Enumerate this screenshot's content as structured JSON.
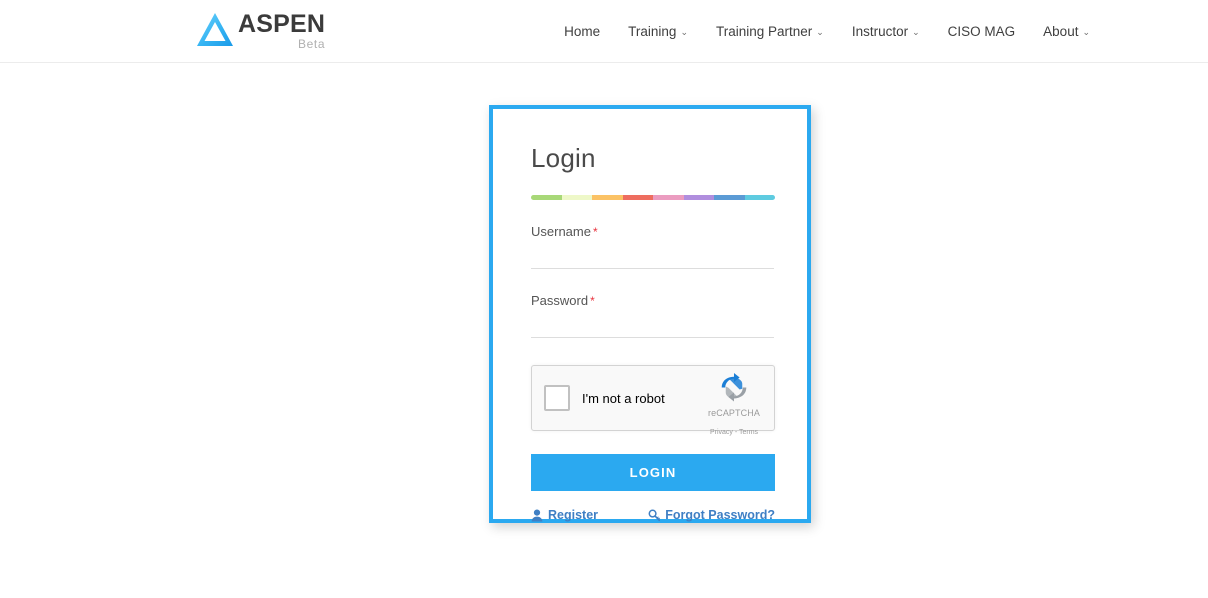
{
  "header": {
    "brand": {
      "name": "ASPEN",
      "sub": "Beta",
      "logo_icon": "triangle-logo-icon",
      "logo_gradient_from": "#5ec8f8",
      "logo_gradient_to": "#1a9ae8"
    },
    "nav": [
      {
        "label": "Home",
        "has_caret": false
      },
      {
        "label": "Training",
        "has_caret": true
      },
      {
        "label": "Training Partner",
        "has_caret": true
      },
      {
        "label": "Instructor",
        "has_caret": true
      },
      {
        "label": "CISO MAG",
        "has_caret": false
      },
      {
        "label": "About",
        "has_caret": true
      }
    ],
    "caret_glyph": "⌄"
  },
  "login_card": {
    "title": "Login",
    "accent_color": "#2ba9f0",
    "rainbow_colors": [
      "#a8d878",
      "#eef8c8",
      "#fbc265",
      "#ee6d5f",
      "#eb9cc0",
      "#b08ede",
      "#5b9bd5",
      "#5ecbe0"
    ],
    "fields": [
      {
        "label": "Username",
        "required_mark": "*",
        "value": "",
        "placeholder": "",
        "type": "text",
        "name": "username-input"
      },
      {
        "label": "Password",
        "required_mark": "*",
        "value": "",
        "placeholder": "",
        "type": "password",
        "name": "password-input"
      }
    ],
    "recaptcha": {
      "label": "I'm not a robot",
      "brand_name": "reCAPTCHA",
      "legal": "Privacy - Terms",
      "checked": false
    },
    "submit_label": "LOGIN",
    "links": [
      {
        "label": "Register",
        "icon": "user-icon"
      },
      {
        "label": "Forgot Password?",
        "icon": "key-search-icon"
      }
    ]
  }
}
